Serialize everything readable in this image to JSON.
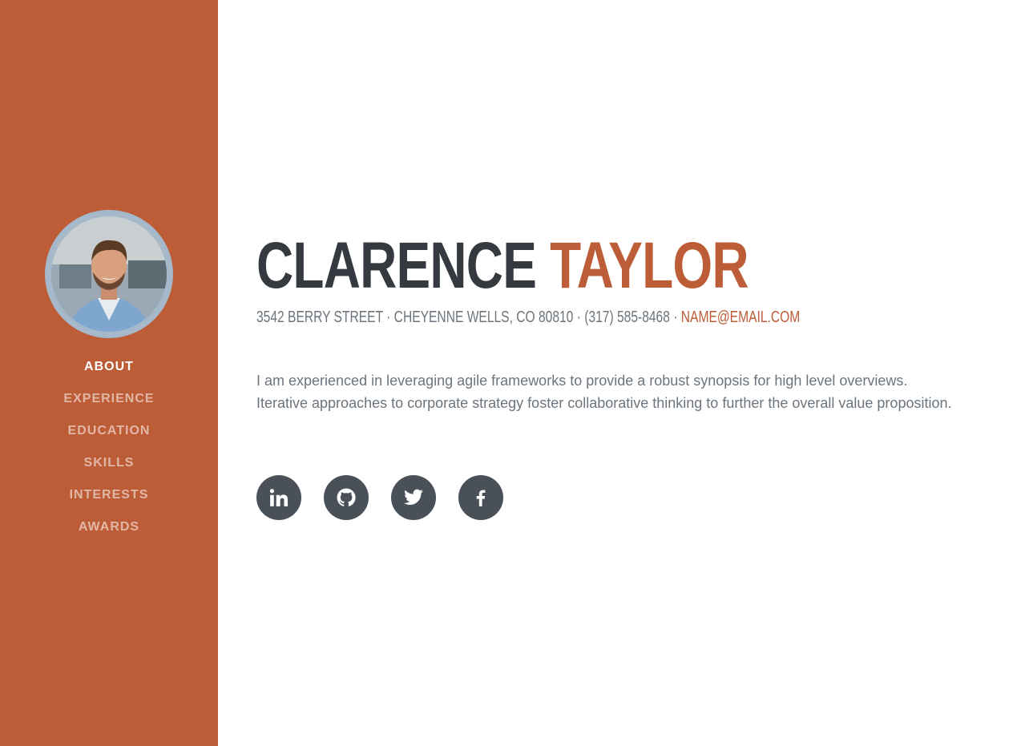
{
  "colors": {
    "primary": "#bd5d38",
    "dark": "#343a40",
    "muted": "#6c757d",
    "icon_bg": "#495057"
  },
  "nav": {
    "items": [
      {
        "label": "ABOUT",
        "active": true
      },
      {
        "label": "EXPERIENCE"
      },
      {
        "label": "EDUCATION"
      },
      {
        "label": "SKILLS"
      },
      {
        "label": "INTERESTS"
      },
      {
        "label": "AWARDS"
      }
    ]
  },
  "profile": {
    "first_name": "CLARENCE",
    "last_name": "TAYLOR",
    "address": "3542 BERRY STREET · CHEYENNE WELLS, CO 80810 · (317) 585-8468 · ",
    "email": "NAME@EMAIL.COM",
    "bio": "I am experienced in leveraging agile frameworks to provide a robust synopsis for high level overviews. Iterative approaches to corporate strategy foster collaborative thinking to further the overall value proposition."
  },
  "social": [
    {
      "icon": "linkedin-icon"
    },
    {
      "icon": "github-icon"
    },
    {
      "icon": "twitter-icon"
    },
    {
      "icon": "facebook-icon"
    }
  ]
}
